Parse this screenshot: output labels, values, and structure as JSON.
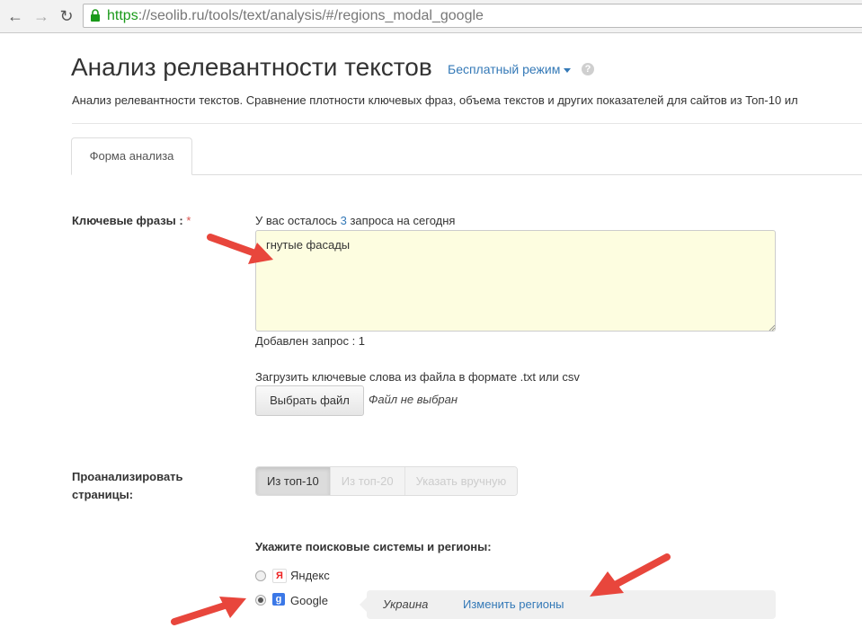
{
  "browser": {
    "url_scheme": "https",
    "url_rest": "://seolib.ru/tools/text/analysis/#/regions_modal_google"
  },
  "header": {
    "title": "Анализ релевантности текстов",
    "mode_link": "Бесплатный режим",
    "help": "?",
    "subtitle": "Анализ релевантности текстов. Сравнение плотности ключевых фраз, объема текстов и других показателей для сайтов из Топ-10 ил"
  },
  "tabs": [
    {
      "label": "Форма анализа",
      "active": true
    }
  ],
  "form": {
    "keywords_label": "Ключевые фразы :",
    "required_mark": "*",
    "remaining_prefix": "У вас осталось",
    "remaining_count": "3",
    "remaining_suffix": "запроса на сегодня",
    "keywords_value": "гнутые фасады",
    "added_text": "Добавлен запрос : 1",
    "upload_text": "Загрузить ключевые слова из файла в формате .txt или csv",
    "file_button": "Выбрать файл",
    "no_file": "Файл не выбран",
    "analyze_label_line1": "Проанализировать",
    "analyze_label_line2": "страницы:",
    "analyze_options": [
      {
        "label": "Из топ-10",
        "active": true
      },
      {
        "label": "Из топ-20",
        "active": false
      },
      {
        "label": "Указать вручную",
        "active": false
      }
    ],
    "engines_title": "Укажите поисковые системы и регионы:",
    "engines": [
      {
        "label": "Яндекс",
        "icon": "yandex-icon",
        "icon_char": "Я",
        "checked": false
      },
      {
        "label": "Google",
        "icon": "google-icon",
        "icon_char": "g",
        "checked": true
      }
    ],
    "region_name": "Украина",
    "change_regions": "Изменить регионы"
  },
  "colors": {
    "link": "#3479b7",
    "arrow": "#e8463c",
    "textarea_bg": "#fdfde0",
    "url_green": "#1a9a1a"
  }
}
